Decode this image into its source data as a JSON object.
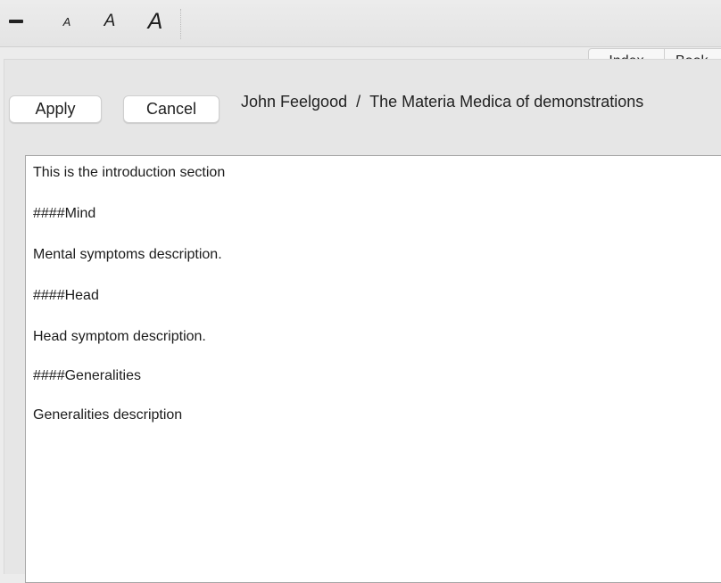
{
  "toolbar": {
    "decrease_icon": "minus-icon",
    "font_small_label": "A",
    "font_medium_label": "A",
    "font_large_label": "A"
  },
  "tabs": [
    {
      "label": "Index"
    },
    {
      "label": "Book"
    }
  ],
  "actions": {
    "apply_label": "Apply",
    "cancel_label": "Cancel"
  },
  "breadcrumb": {
    "author": "John Feelgood",
    "separator": "/",
    "title": "The Materia Medica of demonstrations"
  },
  "editor": {
    "lines": [
      "This is the introduction section",
      "####Mind",
      "Mental symptoms description.",
      "####Head",
      "Head symptom description.",
      "####Generalities",
      "Generalities description"
    ]
  }
}
